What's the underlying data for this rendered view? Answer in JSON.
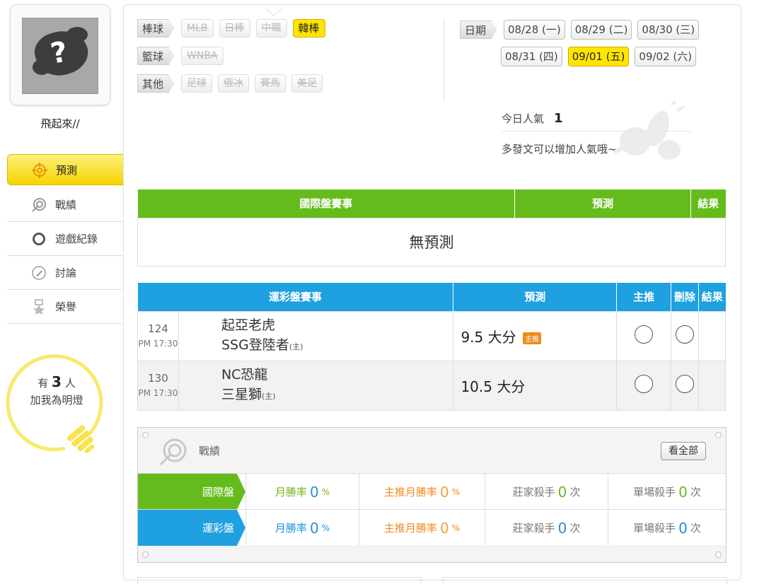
{
  "profile": {
    "username": "飛起來//",
    "avatar_icon": "question-mark-avatar-icon"
  },
  "nav": {
    "items": [
      {
        "label": "預測",
        "icon": "target-icon",
        "active": true
      },
      {
        "label": "戰績",
        "icon": "record-target-icon",
        "active": false
      },
      {
        "label": "遊戲紀錄",
        "icon": "ring-icon",
        "active": false
      },
      {
        "label": "討論",
        "icon": "discussion-icon",
        "active": false
      },
      {
        "label": "榮譽",
        "icon": "medal-icon",
        "active": false
      }
    ]
  },
  "fans": {
    "prefix": "有",
    "count": "3",
    "suffix": "人",
    "line2": "加我為明燈"
  },
  "filters": {
    "baseball": {
      "label": "棒球",
      "chips": [
        "MLB",
        "日棒",
        "中職",
        "韓棒"
      ],
      "active_index": 3
    },
    "basketball": {
      "label": "籃球",
      "chips": [
        "WNBA"
      ]
    },
    "other": {
      "label": "其他",
      "chips": [
        "足球",
        "俄冰",
        "賽馬",
        "美足"
      ]
    }
  },
  "dates": {
    "label": "日期",
    "row1": [
      "08/28 (一)",
      "08/29 (二)",
      "08/30 (三)"
    ],
    "row2": [
      "08/31 (四)",
      "09/01 (五)",
      "09/02 (六)"
    ],
    "active": "09/01 (五)"
  },
  "popularity": {
    "label": "今日人氣",
    "value": "1",
    "hint": "多發文可以增加人氣哦~"
  },
  "international": {
    "headers": [
      "國際盤賽事",
      "預測",
      "結果"
    ],
    "empty_text": "無預測"
  },
  "sports_lottery": {
    "headers": [
      "運彩盤賽事",
      "預測",
      "主推",
      "刪除",
      "結果"
    ],
    "rows": [
      {
        "no": "124",
        "time": "PM 17:30",
        "away": "起亞老虎",
        "home": "SSG登陸者",
        "home_mark": "(主)",
        "prediction": "9.5 大分",
        "badge": "主推"
      },
      {
        "no": "130",
        "time": "PM 17:30",
        "away": "NC恐龍",
        "home": "三星獅",
        "home_mark": "(主)",
        "prediction": "10.5 大分",
        "badge": ""
      }
    ]
  },
  "record": {
    "title": "戰績",
    "see_all": "看全部",
    "rows": [
      {
        "label": "國際盤",
        "color": "#66bb1c",
        "month_label": "月勝率",
        "month_value": "0",
        "month_unit": "%",
        "main_label": "主推月勝率",
        "main_value": "0",
        "main_unit": "%",
        "banker_label": "莊家殺手",
        "banker_value": "0",
        "banker_unit": "次",
        "single_label": "單場殺手",
        "single_value": "0",
        "single_unit": "次"
      },
      {
        "label": "運彩盤",
        "color": "#1ea0e1",
        "month_label": "月勝率",
        "month_value": "0",
        "month_unit": "%",
        "main_label": "主推月勝率",
        "main_value": "0",
        "main_unit": "%",
        "banker_label": "莊家殺手",
        "banker_value": "0",
        "banker_unit": "次",
        "single_label": "單場殺手",
        "single_value": "0",
        "single_unit": "次"
      }
    ]
  },
  "colors": {
    "accent_yellow": "#ffe600",
    "green": "#66bb1c",
    "blue": "#1ea0e1",
    "orange": "#f08a1c"
  }
}
